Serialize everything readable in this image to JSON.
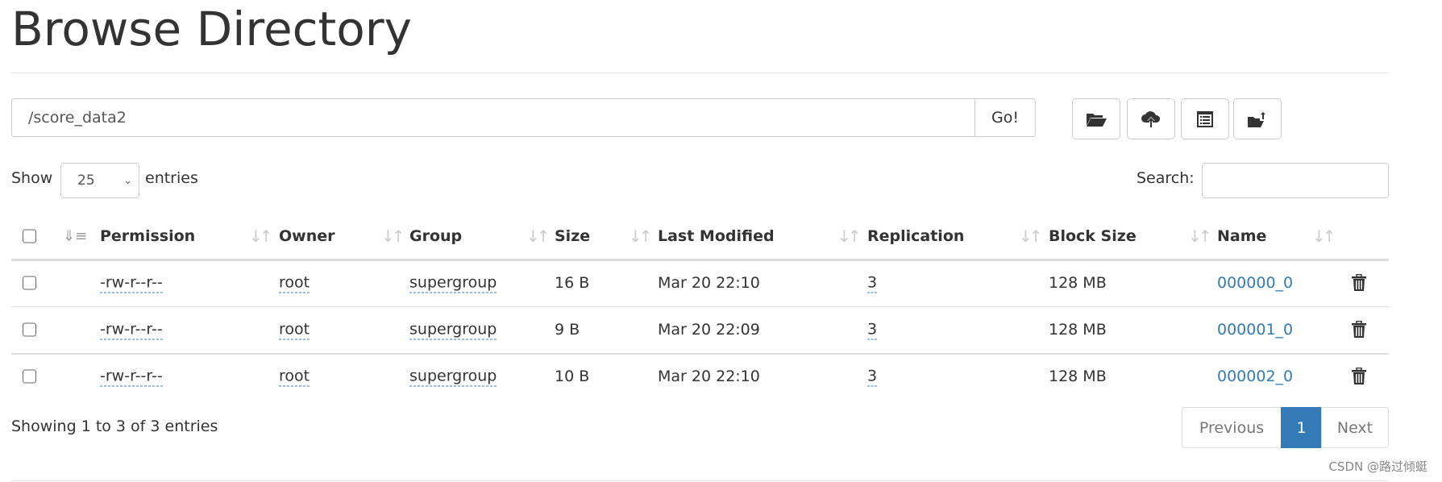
{
  "title": "Browse Directory",
  "path_value": "/score_data2",
  "go_label": "Go!",
  "toolbar": [
    {
      "icon": "folder-open-icon"
    },
    {
      "icon": "cloud-upload-icon"
    },
    {
      "icon": "list-alt-icon"
    },
    {
      "icon": "folder-move-icon"
    }
  ],
  "show_label": "Show",
  "entries_label": "entries",
  "page_size": "25",
  "search_label": "Search:",
  "search_value": "",
  "columns": [
    "Permission",
    "Owner",
    "Group",
    "Size",
    "Last Modified",
    "Replication",
    "Block Size",
    "Name"
  ],
  "rows": [
    {
      "permission": "-rw-r--r--",
      "owner": "root",
      "group": "supergroup",
      "size": "16 B",
      "modified": "Mar 20 22:10",
      "replication": "3",
      "block_size": "128 MB",
      "name": "000000_0"
    },
    {
      "permission": "-rw-r--r--",
      "owner": "root",
      "group": "supergroup",
      "size": "9 B",
      "modified": "Mar 20 22:09",
      "replication": "3",
      "block_size": "128 MB",
      "name": "000001_0"
    },
    {
      "permission": "-rw-r--r--",
      "owner": "root",
      "group": "supergroup",
      "size": "10 B",
      "modified": "Mar 20 22:10",
      "replication": "3",
      "block_size": "128 MB",
      "name": "000002_0"
    }
  ],
  "info": "Showing 1 to 3 of 3 entries",
  "pagination": {
    "previous": "Previous",
    "current": "1",
    "next": "Next"
  },
  "watermark": "CSDN @路过倾蜓",
  "colors": {
    "link": "#337ab7",
    "active_page": "#337ab7"
  }
}
